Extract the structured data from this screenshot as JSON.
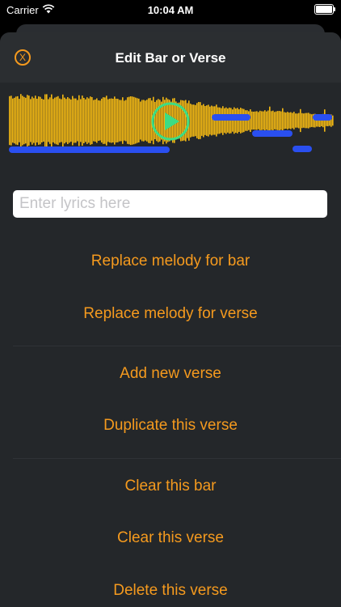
{
  "status": {
    "carrier": "Carrier",
    "time": "10:04 AM"
  },
  "nav": {
    "title": "Edit Bar or Verse",
    "close_glyph": "X"
  },
  "lyrics": {
    "placeholder": "Enter lyrics here",
    "value": ""
  },
  "actions": [
    "Replace melody for bar",
    "Replace melody for verse",
    "Add new verse",
    "Duplicate this verse",
    "Clear this bar",
    "Clear this verse",
    "Delete this verse"
  ],
  "colors": {
    "accent": "#f59a1e",
    "waveform": "#f4b913",
    "melody_notes": "#2a4ff0",
    "play_button": "#3ddc84",
    "sheet_bg": "#24272a"
  }
}
